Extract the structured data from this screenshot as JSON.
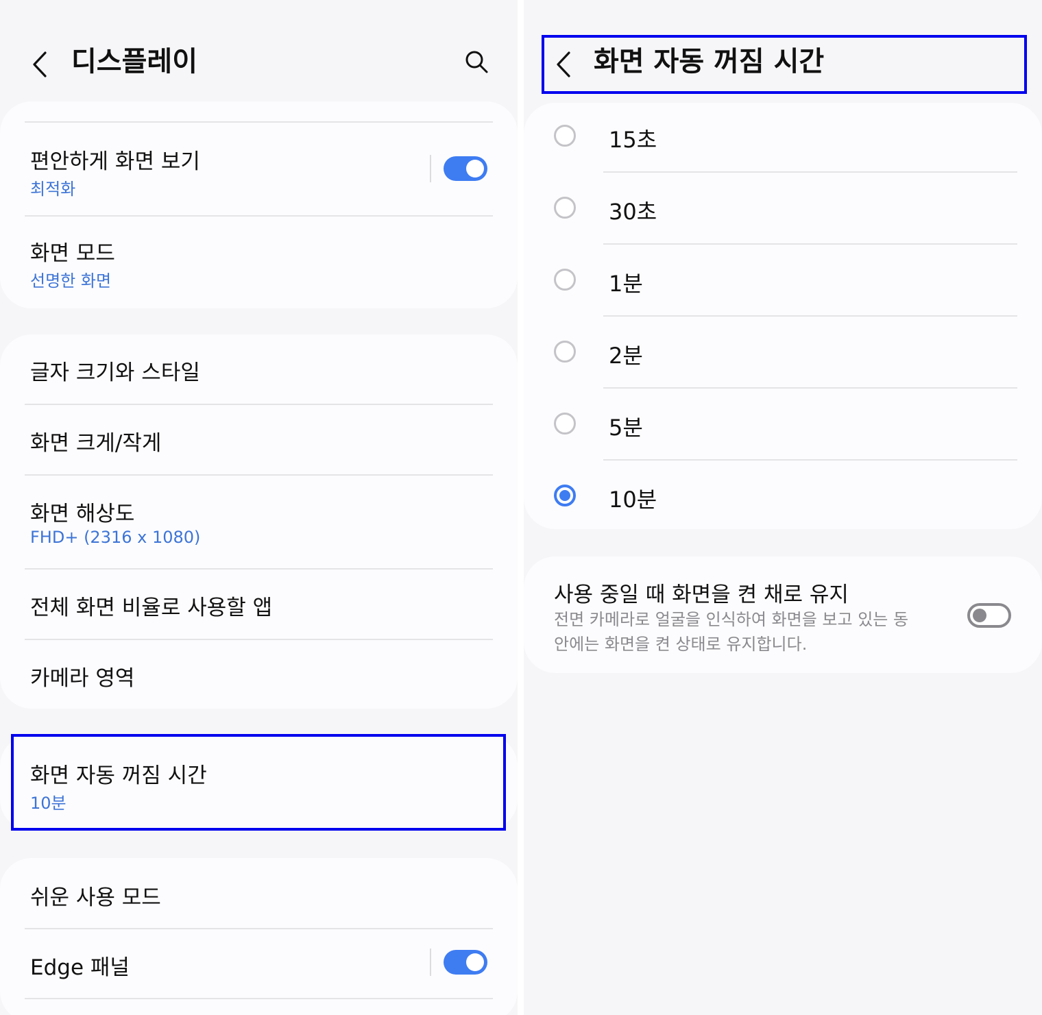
{
  "left": {
    "title": "디스플레이",
    "items": [
      {
        "title": "편안하게 화면 보기",
        "subtitle": "최적화",
        "toggle": true
      },
      {
        "title": "화면 모드",
        "subtitle": "선명한 화면"
      },
      {
        "title": "글자 크기와 스타일"
      },
      {
        "title": "화면 크게/작게"
      },
      {
        "title": "화면 해상도",
        "subtitle": "FHD+ (2316 x 1080)"
      },
      {
        "title": "전체 화면 비율로 사용할 앱"
      },
      {
        "title": "카메라 영역"
      },
      {
        "title": "화면 자동 꺼짐 시간",
        "subtitle": "10분"
      },
      {
        "title": "쉬운 사용 모드"
      },
      {
        "title": "Edge 패널",
        "toggle": true
      }
    ]
  },
  "right": {
    "title": "화면 자동 꺼짐 시간",
    "options": [
      {
        "label": "15초",
        "selected": false
      },
      {
        "label": "30초",
        "selected": false
      },
      {
        "label": "1분",
        "selected": false
      },
      {
        "label": "2분",
        "selected": false
      },
      {
        "label": "5분",
        "selected": false
      },
      {
        "label": "10분",
        "selected": true
      }
    ],
    "keep_on": {
      "title": "사용 중일 때 화면을 켠 채로 유지",
      "description": "전면 카메라로 얼굴을 인식하여 화면을 보고 있는 동안에는 화면을 켠 상태로 유지합니다.",
      "toggle": false
    }
  },
  "colors": {
    "accent": "#3e7cf2",
    "subtitle": "#3d74d6",
    "highlight": "#0000ee",
    "background": "#f6f6f8"
  },
  "icons": [
    "back-icon",
    "search-icon"
  ]
}
